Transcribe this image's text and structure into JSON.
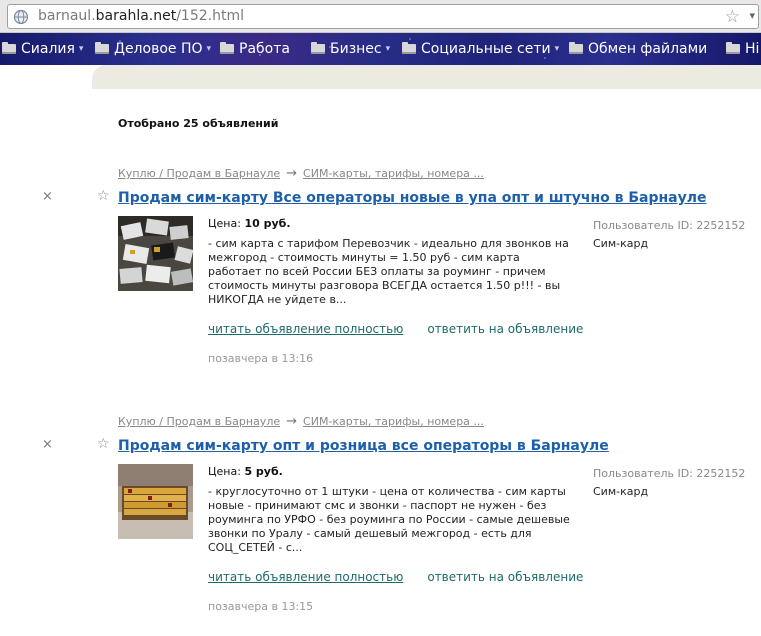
{
  "browser": {
    "url_prefix": "barnaul.",
    "url_domain": "barahla.net",
    "url_path": "/152.html"
  },
  "nav": {
    "items": [
      {
        "label": "Сиалия",
        "has_menu": true
      },
      {
        "label": "Деловое ПО",
        "has_menu": true
      },
      {
        "label": "Работа",
        "has_menu": false
      },
      {
        "label": "Бизнес",
        "has_menu": true
      },
      {
        "label": "Социальные сети",
        "has_menu": true
      },
      {
        "label": "Обмен файлами",
        "has_menu": false
      },
      {
        "label": "Hi",
        "has_menu": false
      }
    ]
  },
  "results": {
    "count_text": "Отобрано 25 объявлений"
  },
  "listings": [
    {
      "crumb_1": "Куплю / Продам в Барнауле",
      "crumb_arrow": "→",
      "crumb_2": "СИМ-карты, тарифы, номера ...",
      "title": "Продам сим-карту Все операторы новые в упа опт и штучно в Барнауле",
      "price_label": "Цена:",
      "price_value": "10 руб.",
      "description": "- сим карта с тарифом Перевозчик - идеально для звонков на межгород - стоимость минуты = 1.50 руб - сим карта работает по всей России БЕЗ оплаты за роуминг - причем стоимость минуты разговора ВСЕГДА остается 1.50 р!!! - вы НИКОГДА не уйдете в...",
      "read_label": "читать объявление полностью",
      "reply_label": "ответить на объявление",
      "time": "позавчера в 13:16",
      "user_id": "Пользователь ID: 2252152",
      "user_name": "Сим-кард"
    },
    {
      "crumb_1": "Куплю / Продам в Барнауле",
      "crumb_arrow": "→",
      "crumb_2": "СИМ-карты, тарифы, номера ...",
      "title": "Продам сим-карту опт и розница все операторы в Барнауле",
      "price_label": "Цена:",
      "price_value": "5 руб.",
      "description": "- круглосуточно от 1 штуки - цена от количества - сим карты новые - принимают смс и звонки - паспорт не нужен - без роуминга по УРФО - без роуминга по России - самые дешевые звонки по Уралу - самый дешевый межгород - есть для СОЦ_СЕТЕЙ - с...",
      "read_label": "читать объявление полностью",
      "reply_label": "ответить на объявление",
      "time": "позавчера в 13:15",
      "user_id": "Пользователь ID: 2252152",
      "user_name": "Сим-кард"
    }
  ],
  "icons": {
    "close": "×",
    "favorite": "☆",
    "bookmark": "☆",
    "dropdown": "▾"
  }
}
